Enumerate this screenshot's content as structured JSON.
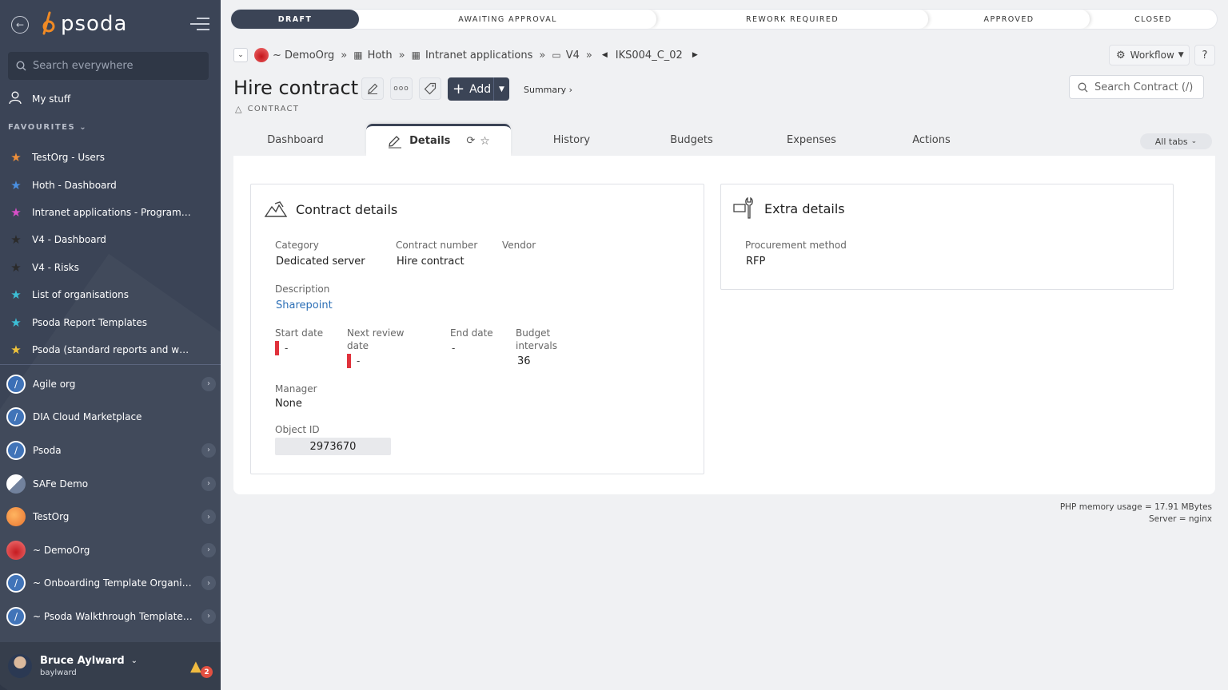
{
  "sidebar": {
    "brand": "psoda",
    "search_placeholder": "Search everywhere",
    "my_stuff": "My stuff",
    "favourites_heading": "FAVOURITES",
    "favourites": [
      {
        "label": "TestOrg - Users",
        "color": "#f0903a"
      },
      {
        "label": "Hoth - Dashboard",
        "color": "#4a90e2"
      },
      {
        "label": "Intranet applications - Programme...",
        "color": "#d94fc9"
      },
      {
        "label": "V4 - Dashboard",
        "color": "#2b2b2b"
      },
      {
        "label": "V4 - Risks",
        "color": "#2b2b2b"
      },
      {
        "label": "List of organisations",
        "color": "#3cbfd6"
      },
      {
        "label": "Psoda Report Templates",
        "color": "#3cbfd6"
      },
      {
        "label": "Psoda (standard reports and work...",
        "color": "#f0c43a"
      }
    ],
    "orgs": [
      {
        "label": "Agile org",
        "icon": "blue",
        "chevron": true
      },
      {
        "label": "DIA Cloud Marketplace",
        "icon": "blue",
        "chevron": false
      },
      {
        "label": "Psoda",
        "icon": "blue",
        "chevron": true
      },
      {
        "label": "SAFe Demo",
        "icon": "safe",
        "chevron": true
      },
      {
        "label": "TestOrg",
        "icon": "orange",
        "chevron": true
      },
      {
        "label": "~ DemoOrg",
        "icon": "red",
        "chevron": true
      },
      {
        "label": "~ Onboarding Template Organisa...",
        "icon": "blue",
        "chevron": true
      },
      {
        "label": "~ Psoda Walkthrough Template P...",
        "icon": "blue",
        "chevron": true
      }
    ],
    "user": {
      "name": "Bruce Aylward",
      "handle": "baylward",
      "notifications": "2"
    }
  },
  "workflow_steps": [
    "DRAFT",
    "AWAITING APPROVAL",
    "REWORK REQUIRED",
    "APPROVED",
    "CLOSED"
  ],
  "breadcrumb": {
    "org": "~ DemoOrg",
    "items": [
      "Hoth",
      "Intranet applications",
      "V4"
    ],
    "current": "IKS004_C_02"
  },
  "header": {
    "title": "Hire contract",
    "object_type": "CONTRACT",
    "add_label": "Add",
    "summary_label": "Summary ›",
    "workflow_label": "Workflow",
    "help_label": "?",
    "search_placeholder": "Search Contract (/)"
  },
  "tabs": [
    "Dashboard",
    "Details",
    "History",
    "Budgets",
    "Expenses",
    "Actions"
  ],
  "all_tabs_label": "All tabs",
  "contract_details": {
    "title": "Contract details",
    "category_label": "Category",
    "category": "Dedicated server",
    "contract_number_label": "Contract number",
    "contract_number": "Hire contract",
    "vendor_label": "Vendor",
    "description_label": "Description",
    "description": "Sharepoint",
    "start_date_label": "Start date",
    "start_date": "-",
    "next_review_label_1": "Next review",
    "next_review_label_2": "date",
    "next_review": "-",
    "end_date_label": "End date",
    "end_date": "-",
    "budget_intervals_label_1": "Budget",
    "budget_intervals_label_2": "intervals",
    "budget_intervals": "36",
    "manager_label": "Manager",
    "manager": "None",
    "object_id_label": "Object ID",
    "object_id": "2973670"
  },
  "extra_details": {
    "title": "Extra details",
    "procurement_label": "Procurement method",
    "procurement": "RFP"
  },
  "footer": {
    "memory": "PHP memory usage = 17.91 MBytes",
    "server": "Server = nginx"
  }
}
